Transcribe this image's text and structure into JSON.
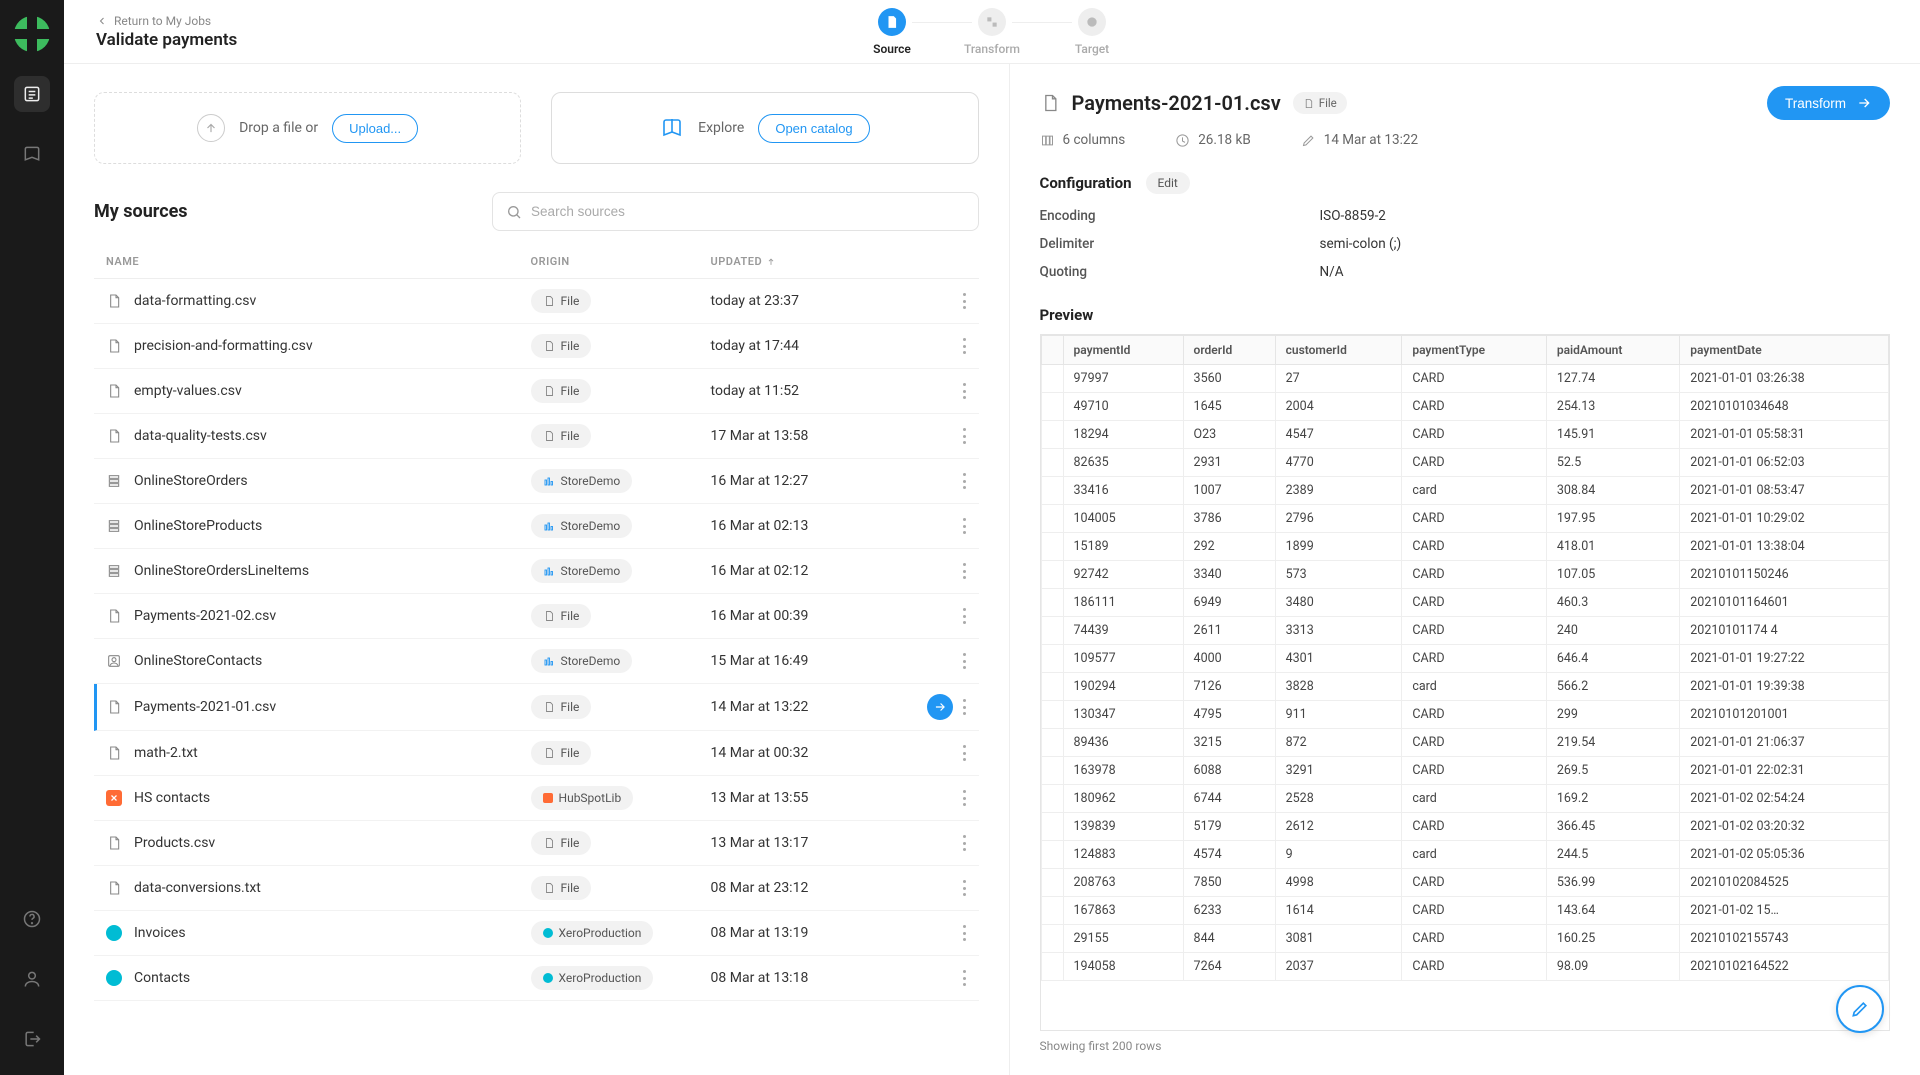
{
  "nav": {
    "back": "Return to My Jobs",
    "title": "Validate payments"
  },
  "steps": [
    {
      "label": "Source",
      "active": true
    },
    {
      "label": "Transform",
      "active": false
    },
    {
      "label": "Target",
      "active": false
    }
  ],
  "drop": {
    "text": "Drop a file or",
    "upload": "Upload..."
  },
  "explore": {
    "text": "Explore",
    "catalog": "Open catalog"
  },
  "sources": {
    "title": "My sources",
    "searchPlaceholder": "Search sources",
    "columns": {
      "name": "NAME",
      "origin": "ORIGIN",
      "updated": "UPDATED"
    },
    "rows": [
      {
        "icon": "file",
        "name": "data-formatting.csv",
        "originType": "file",
        "origin": "File",
        "updated": "today at 23:37"
      },
      {
        "icon": "file",
        "name": "precision-and-formatting.csv",
        "originType": "file",
        "origin": "File",
        "updated": "today at 17:44"
      },
      {
        "icon": "file",
        "name": "empty-values.csv",
        "originType": "file",
        "origin": "File",
        "updated": "today at 11:52"
      },
      {
        "icon": "file",
        "name": "data-quality-tests.csv",
        "originType": "file",
        "origin": "File",
        "updated": "17 Mar at 13:58"
      },
      {
        "icon": "db",
        "name": "OnlineStoreOrders",
        "originType": "store",
        "origin": "StoreDemo",
        "updated": "16 Mar at 12:27"
      },
      {
        "icon": "db",
        "name": "OnlineStoreProducts",
        "originType": "store",
        "origin": "StoreDemo",
        "updated": "16 Mar at 02:13"
      },
      {
        "icon": "db",
        "name": "OnlineStoreOrdersLineItems",
        "originType": "store",
        "origin": "StoreDemo",
        "updated": "16 Mar at 02:12"
      },
      {
        "icon": "file",
        "name": "Payments-2021-02.csv",
        "originType": "file",
        "origin": "File",
        "updated": "16 Mar at 00:39"
      },
      {
        "icon": "contact",
        "name": "OnlineStoreContacts",
        "originType": "store",
        "origin": "StoreDemo",
        "updated": "15 Mar at 16:49"
      },
      {
        "icon": "file",
        "name": "Payments-2021-01.csv",
        "originType": "file",
        "origin": "File",
        "updated": "14 Mar at 13:22",
        "selected": true
      },
      {
        "icon": "file",
        "name": "math-2.txt",
        "originType": "file",
        "origin": "File",
        "updated": "14 Mar at 00:32"
      },
      {
        "icon": "hubspot",
        "name": "HS contacts",
        "originType": "hubspot",
        "origin": "HubSpotLib",
        "updated": "13 Mar at 13:55"
      },
      {
        "icon": "file",
        "name": "Products.csv",
        "originType": "file",
        "origin": "File",
        "updated": "13 Mar at 13:17"
      },
      {
        "icon": "file",
        "name": "data-conversions.txt",
        "originType": "file",
        "origin": "File",
        "updated": "08 Mar at 23:12"
      },
      {
        "icon": "xero",
        "name": "Invoices",
        "originType": "xero",
        "origin": "XeroProduction",
        "updated": "08 Mar at 13:19"
      },
      {
        "icon": "xero",
        "name": "Contacts",
        "originType": "xero",
        "origin": "XeroProduction",
        "updated": "08 Mar at 13:18"
      }
    ]
  },
  "detail": {
    "filename": "Payments-2021-01.csv",
    "fileBadge": "File",
    "transformBtn": "Transform",
    "meta": {
      "columns": "6 columns",
      "size": "26.18 kB",
      "modified": "14 Mar at 13:22"
    },
    "configTitle": "Configuration",
    "editLabel": "Edit",
    "config": [
      {
        "k": "Encoding",
        "v": "ISO-8859-2"
      },
      {
        "k": "Delimiter",
        "v": "semi-colon (;)"
      },
      {
        "k": "Quoting",
        "v": "N/A"
      }
    ],
    "previewTitle": "Preview",
    "previewColumns": [
      "paymentId",
      "orderId",
      "customerId",
      "paymentType",
      "paidAmount",
      "paymentDate"
    ],
    "previewRows": [
      [
        "97997",
        "3560",
        "27",
        "CARD",
        "127.74",
        "2021-01-01 03:26:38"
      ],
      [
        "49710",
        "1645",
        "2004",
        "CARD",
        "254.13",
        "20210101034648"
      ],
      [
        "18294",
        "O23",
        "4547",
        "CARD",
        "145.91",
        "2021-01-01 05:58:31"
      ],
      [
        "82635",
        "2931",
        "4770",
        "CARD",
        "52.5",
        "2021-01-01 06:52:03"
      ],
      [
        "33416",
        "1007",
        "2389",
        "card",
        "308.84",
        "2021-01-01 08:53:47"
      ],
      [
        "104005",
        "3786",
        "2796",
        "CARD",
        "197.95",
        "2021-01-01 10:29:02"
      ],
      [
        "15189",
        "292",
        "1899",
        "CARD",
        "418.01",
        "2021-01-01 13:38:04"
      ],
      [
        "92742",
        "3340",
        "573",
        "CARD",
        "107.05",
        "20210101150246"
      ],
      [
        "186111",
        "6949",
        "3480",
        "CARD",
        "460.3",
        "20210101164601"
      ],
      [
        "74439",
        "2611",
        "3313",
        "CARD",
        "240",
        "20210101174 4"
      ],
      [
        "109577",
        "4000",
        "4301",
        "CARD",
        "646.4",
        "2021-01-01 19:27:22"
      ],
      [
        "190294",
        "7126",
        "3828",
        "card",
        "566.2",
        "2021-01-01 19:39:38"
      ],
      [
        "130347",
        "4795",
        "911",
        "CARD",
        "299",
        "20210101201001"
      ],
      [
        "89436",
        "3215",
        "872",
        "CARD",
        "219.54",
        "2021-01-01 21:06:37"
      ],
      [
        "163978",
        "6088",
        "3291",
        "CARD",
        "269.5",
        "2021-01-01 22:02:31"
      ],
      [
        "180962",
        "6744",
        "2528",
        "card",
        "169.2",
        "2021-01-02 02:54:24"
      ],
      [
        "139839",
        "5179",
        "2612",
        "CARD",
        "366.45",
        "2021-01-02 03:20:32"
      ],
      [
        "124883",
        "4574",
        "9",
        "card",
        "244.5",
        "2021-01-02 05:05:36"
      ],
      [
        "208763",
        "7850",
        "4998",
        "CARD",
        "536.99",
        "20210102084525"
      ],
      [
        "167863",
        "6233",
        "1614",
        "CARD",
        "143.64",
        "2021-01-02 15…"
      ],
      [
        "29155",
        "844",
        "3081",
        "CARD",
        "160.25",
        "20210102155743"
      ],
      [
        "194058",
        "7264",
        "2037",
        "CARD",
        "98.09",
        "20210102164522"
      ]
    ],
    "showing": "Showing first 200 rows"
  }
}
